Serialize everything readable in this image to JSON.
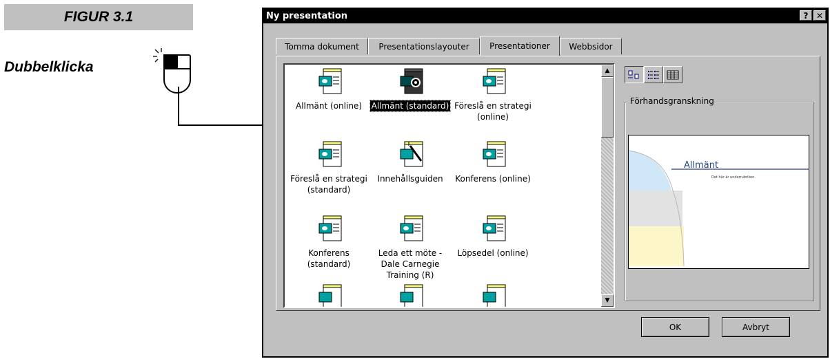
{
  "figure_label": "FIGUR 3.1",
  "instruction_label": "Dubbelklicka",
  "dialog": {
    "title": "Ny presentation",
    "help_button": "?",
    "close_button": "✕",
    "tabs": [
      {
        "label": "Tomma dokument"
      },
      {
        "label": "Presentationslayouter"
      },
      {
        "label": "Presentationer"
      },
      {
        "label": "Webbsidor"
      }
    ],
    "active_tab": "Presentationer",
    "files": [
      {
        "label": "Allmänt (online)"
      },
      {
        "label": "Allmänt (standard)"
      },
      {
        "label": "Föreslå en strategi (online)"
      },
      {
        "label": "Föreslå en strategi (standard)"
      },
      {
        "label": "Innehållsguiden"
      },
      {
        "label": "Konferens (online)"
      },
      {
        "label": "Konferens (standard)"
      },
      {
        "label": "Leda ett möte - Dale Carnegie Training (R)"
      },
      {
        "label": "Löpsedel (online)"
      }
    ],
    "selected_file": "Allmänt (standard)",
    "preview": {
      "group_label": "Förhandsgranskning",
      "slide_title": "Allmänt",
      "slide_subtitle": "Det här är underrubriken."
    },
    "buttons": {
      "ok": "OK",
      "cancel": "Avbryt"
    },
    "view_modes": [
      "large-icons",
      "list",
      "details"
    ]
  },
  "colors": {
    "dialog_bg": "#c0c0c0",
    "titlebar_bg": "#000000",
    "selection_bg": "#000000",
    "preview_title": "#2a4a8a"
  }
}
